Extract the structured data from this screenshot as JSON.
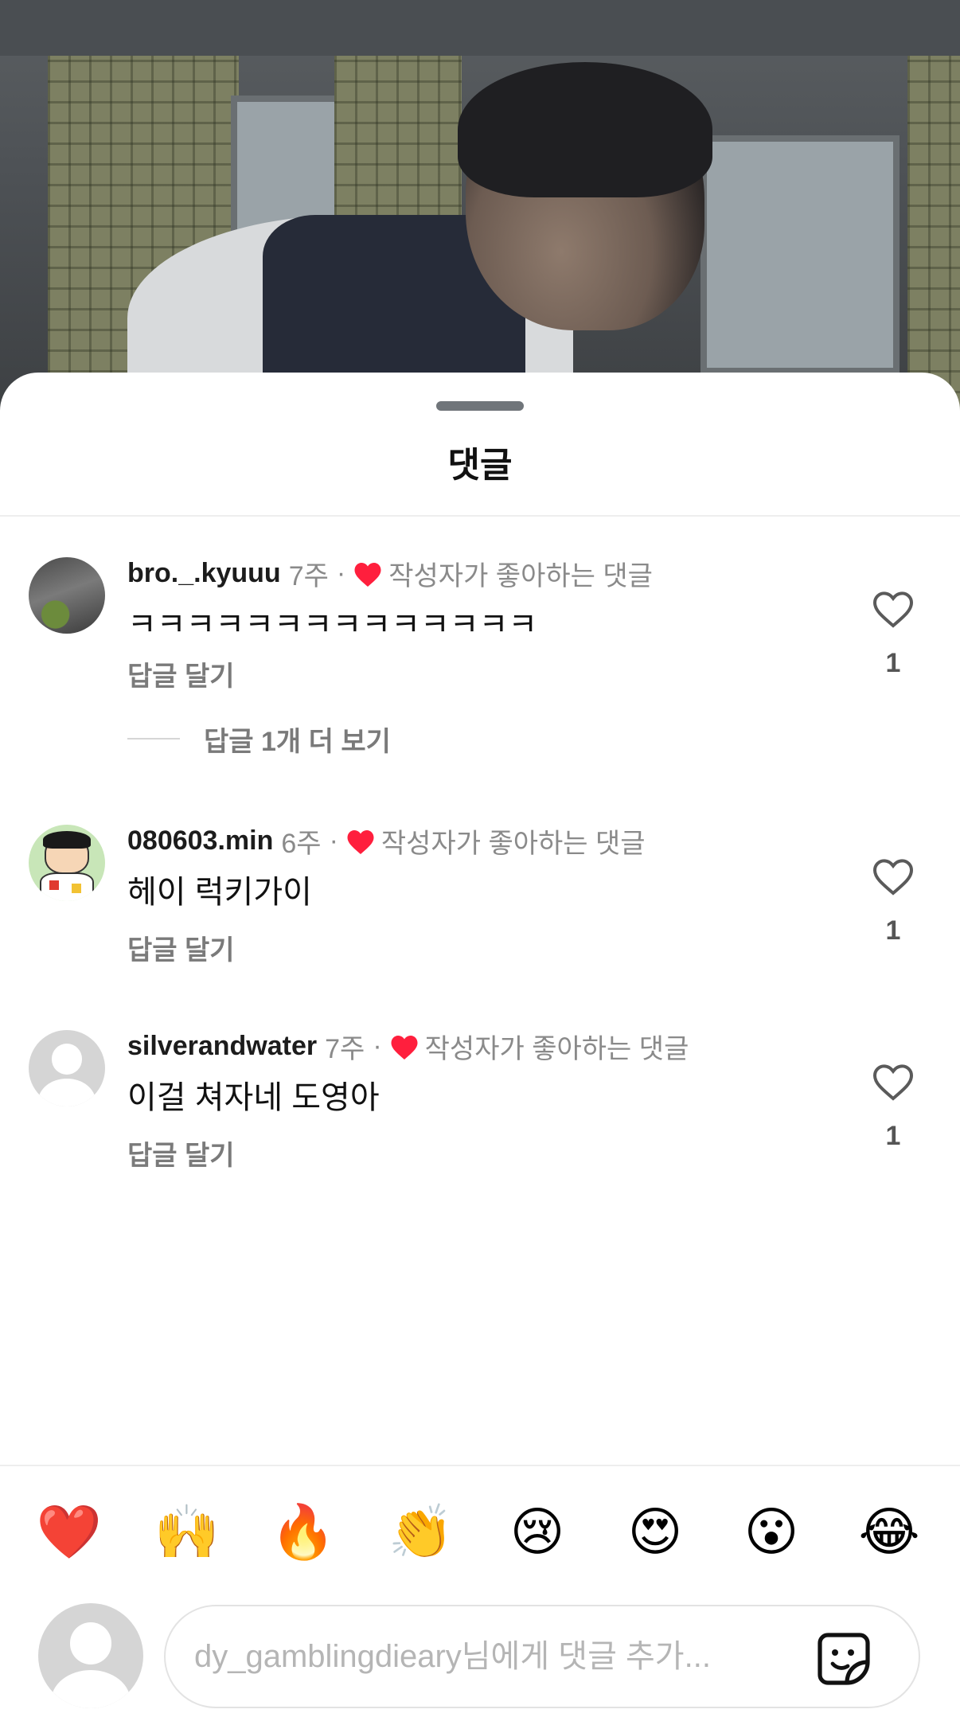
{
  "sheet": {
    "title": "댓글"
  },
  "comments": [
    {
      "username": "bro._.kyuuu",
      "time": "7주",
      "separator": "·",
      "creator_label": "작성자가 좋아하는 댓글",
      "text": "ㅋㅋㅋㅋㅋㅋㅋㅋㅋㅋㅋㅋㅋㅋ",
      "reply_label": "답글 달기",
      "like_count": "1",
      "more_replies_label": "답글 1개 더 보기"
    },
    {
      "username": "080603.min",
      "time": "6주",
      "separator": "·",
      "creator_label": "작성자가 좋아하는 댓글",
      "text": "헤이 럭키가이",
      "reply_label": "답글 달기",
      "like_count": "1"
    },
    {
      "username": "silverandwater",
      "time": "7주",
      "separator": "·",
      "creator_label": "작성자가 좋아하는 댓글",
      "text": "이걸 쳐자네 도영아",
      "reply_label": "답글 달기",
      "like_count": "1"
    }
  ],
  "quick_reactions": [
    "❤️",
    "🙌",
    "🔥",
    "👏",
    "😢",
    "😍",
    "😮",
    "😂"
  ],
  "composer": {
    "placeholder": "dy_gamblingdieary님에게 댓글 추가...",
    "value": ""
  },
  "colors": {
    "creator_heart": "#ff1f3d",
    "secondary_text": "#8a8a8a",
    "sheet_background": "#ffffff"
  },
  "icons": {
    "like": "heart-outline-icon",
    "creator_like": "heart-filled-icon",
    "sticker": "sticker-icon",
    "avatar_default": "person-silhouette-icon"
  }
}
